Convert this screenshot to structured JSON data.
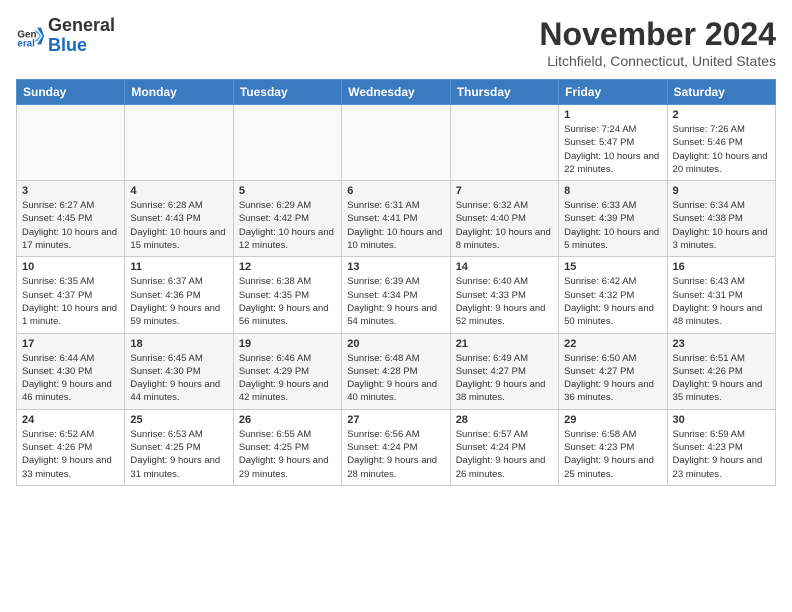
{
  "header": {
    "logo_general": "General",
    "logo_blue": "Blue",
    "month_title": "November 2024",
    "location": "Litchfield, Connecticut, United States"
  },
  "days_of_week": [
    "Sunday",
    "Monday",
    "Tuesday",
    "Wednesday",
    "Thursday",
    "Friday",
    "Saturday"
  ],
  "weeks": [
    [
      {
        "day": "",
        "content": ""
      },
      {
        "day": "",
        "content": ""
      },
      {
        "day": "",
        "content": ""
      },
      {
        "day": "",
        "content": ""
      },
      {
        "day": "",
        "content": ""
      },
      {
        "day": "1",
        "content": "Sunrise: 7:24 AM\nSunset: 5:47 PM\nDaylight: 10 hours and 22 minutes."
      },
      {
        "day": "2",
        "content": "Sunrise: 7:26 AM\nSunset: 5:46 PM\nDaylight: 10 hours and 20 minutes."
      }
    ],
    [
      {
        "day": "3",
        "content": "Sunrise: 6:27 AM\nSunset: 4:45 PM\nDaylight: 10 hours and 17 minutes."
      },
      {
        "day": "4",
        "content": "Sunrise: 6:28 AM\nSunset: 4:43 PM\nDaylight: 10 hours and 15 minutes."
      },
      {
        "day": "5",
        "content": "Sunrise: 6:29 AM\nSunset: 4:42 PM\nDaylight: 10 hours and 12 minutes."
      },
      {
        "day": "6",
        "content": "Sunrise: 6:31 AM\nSunset: 4:41 PM\nDaylight: 10 hours and 10 minutes."
      },
      {
        "day": "7",
        "content": "Sunrise: 6:32 AM\nSunset: 4:40 PM\nDaylight: 10 hours and 8 minutes."
      },
      {
        "day": "8",
        "content": "Sunrise: 6:33 AM\nSunset: 4:39 PM\nDaylight: 10 hours and 5 minutes."
      },
      {
        "day": "9",
        "content": "Sunrise: 6:34 AM\nSunset: 4:38 PM\nDaylight: 10 hours and 3 minutes."
      }
    ],
    [
      {
        "day": "10",
        "content": "Sunrise: 6:35 AM\nSunset: 4:37 PM\nDaylight: 10 hours and 1 minute."
      },
      {
        "day": "11",
        "content": "Sunrise: 6:37 AM\nSunset: 4:36 PM\nDaylight: 9 hours and 59 minutes."
      },
      {
        "day": "12",
        "content": "Sunrise: 6:38 AM\nSunset: 4:35 PM\nDaylight: 9 hours and 56 minutes."
      },
      {
        "day": "13",
        "content": "Sunrise: 6:39 AM\nSunset: 4:34 PM\nDaylight: 9 hours and 54 minutes."
      },
      {
        "day": "14",
        "content": "Sunrise: 6:40 AM\nSunset: 4:33 PM\nDaylight: 9 hours and 52 minutes."
      },
      {
        "day": "15",
        "content": "Sunrise: 6:42 AM\nSunset: 4:32 PM\nDaylight: 9 hours and 50 minutes."
      },
      {
        "day": "16",
        "content": "Sunrise: 6:43 AM\nSunset: 4:31 PM\nDaylight: 9 hours and 48 minutes."
      }
    ],
    [
      {
        "day": "17",
        "content": "Sunrise: 6:44 AM\nSunset: 4:30 PM\nDaylight: 9 hours and 46 minutes."
      },
      {
        "day": "18",
        "content": "Sunrise: 6:45 AM\nSunset: 4:30 PM\nDaylight: 9 hours and 44 minutes."
      },
      {
        "day": "19",
        "content": "Sunrise: 6:46 AM\nSunset: 4:29 PM\nDaylight: 9 hours and 42 minutes."
      },
      {
        "day": "20",
        "content": "Sunrise: 6:48 AM\nSunset: 4:28 PM\nDaylight: 9 hours and 40 minutes."
      },
      {
        "day": "21",
        "content": "Sunrise: 6:49 AM\nSunset: 4:27 PM\nDaylight: 9 hours and 38 minutes."
      },
      {
        "day": "22",
        "content": "Sunrise: 6:50 AM\nSunset: 4:27 PM\nDaylight: 9 hours and 36 minutes."
      },
      {
        "day": "23",
        "content": "Sunrise: 6:51 AM\nSunset: 4:26 PM\nDaylight: 9 hours and 35 minutes."
      }
    ],
    [
      {
        "day": "24",
        "content": "Sunrise: 6:52 AM\nSunset: 4:26 PM\nDaylight: 9 hours and 33 minutes."
      },
      {
        "day": "25",
        "content": "Sunrise: 6:53 AM\nSunset: 4:25 PM\nDaylight: 9 hours and 31 minutes."
      },
      {
        "day": "26",
        "content": "Sunrise: 6:55 AM\nSunset: 4:25 PM\nDaylight: 9 hours and 29 minutes."
      },
      {
        "day": "27",
        "content": "Sunrise: 6:56 AM\nSunset: 4:24 PM\nDaylight: 9 hours and 28 minutes."
      },
      {
        "day": "28",
        "content": "Sunrise: 6:57 AM\nSunset: 4:24 PM\nDaylight: 9 hours and 26 minutes."
      },
      {
        "day": "29",
        "content": "Sunrise: 6:58 AM\nSunset: 4:23 PM\nDaylight: 9 hours and 25 minutes."
      },
      {
        "day": "30",
        "content": "Sunrise: 6:59 AM\nSunset: 4:23 PM\nDaylight: 9 hours and 23 minutes."
      }
    ]
  ]
}
